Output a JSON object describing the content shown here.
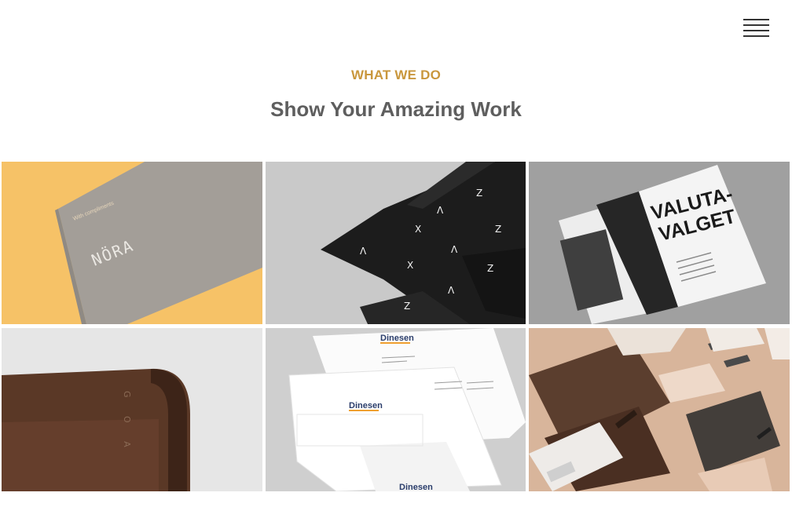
{
  "nav": {
    "menu_icon": "hamburger-menu-icon"
  },
  "section": {
    "eyebrow": "WHAT WE DO",
    "title": "Show Your Amazing Work"
  },
  "portfolio": {
    "items": [
      {
        "name": "nora-stationery",
        "card_small": "With compliments",
        "card_brand": "NÖRA"
      },
      {
        "name": "black-tissue-paper",
        "marks": [
          "Z",
          "X",
          "Λ",
          "Z",
          "X",
          "Λ",
          "Z",
          "X"
        ]
      },
      {
        "name": "valuta-magazine",
        "headline_1": "VALUTA-",
        "headline_2": "VALGET"
      },
      {
        "name": "goa-leather-folder",
        "emboss": "G O A"
      },
      {
        "name": "dinesen-letterhead",
        "brand": "Dinesen"
      },
      {
        "name": "brown-identity-set"
      }
    ]
  }
}
